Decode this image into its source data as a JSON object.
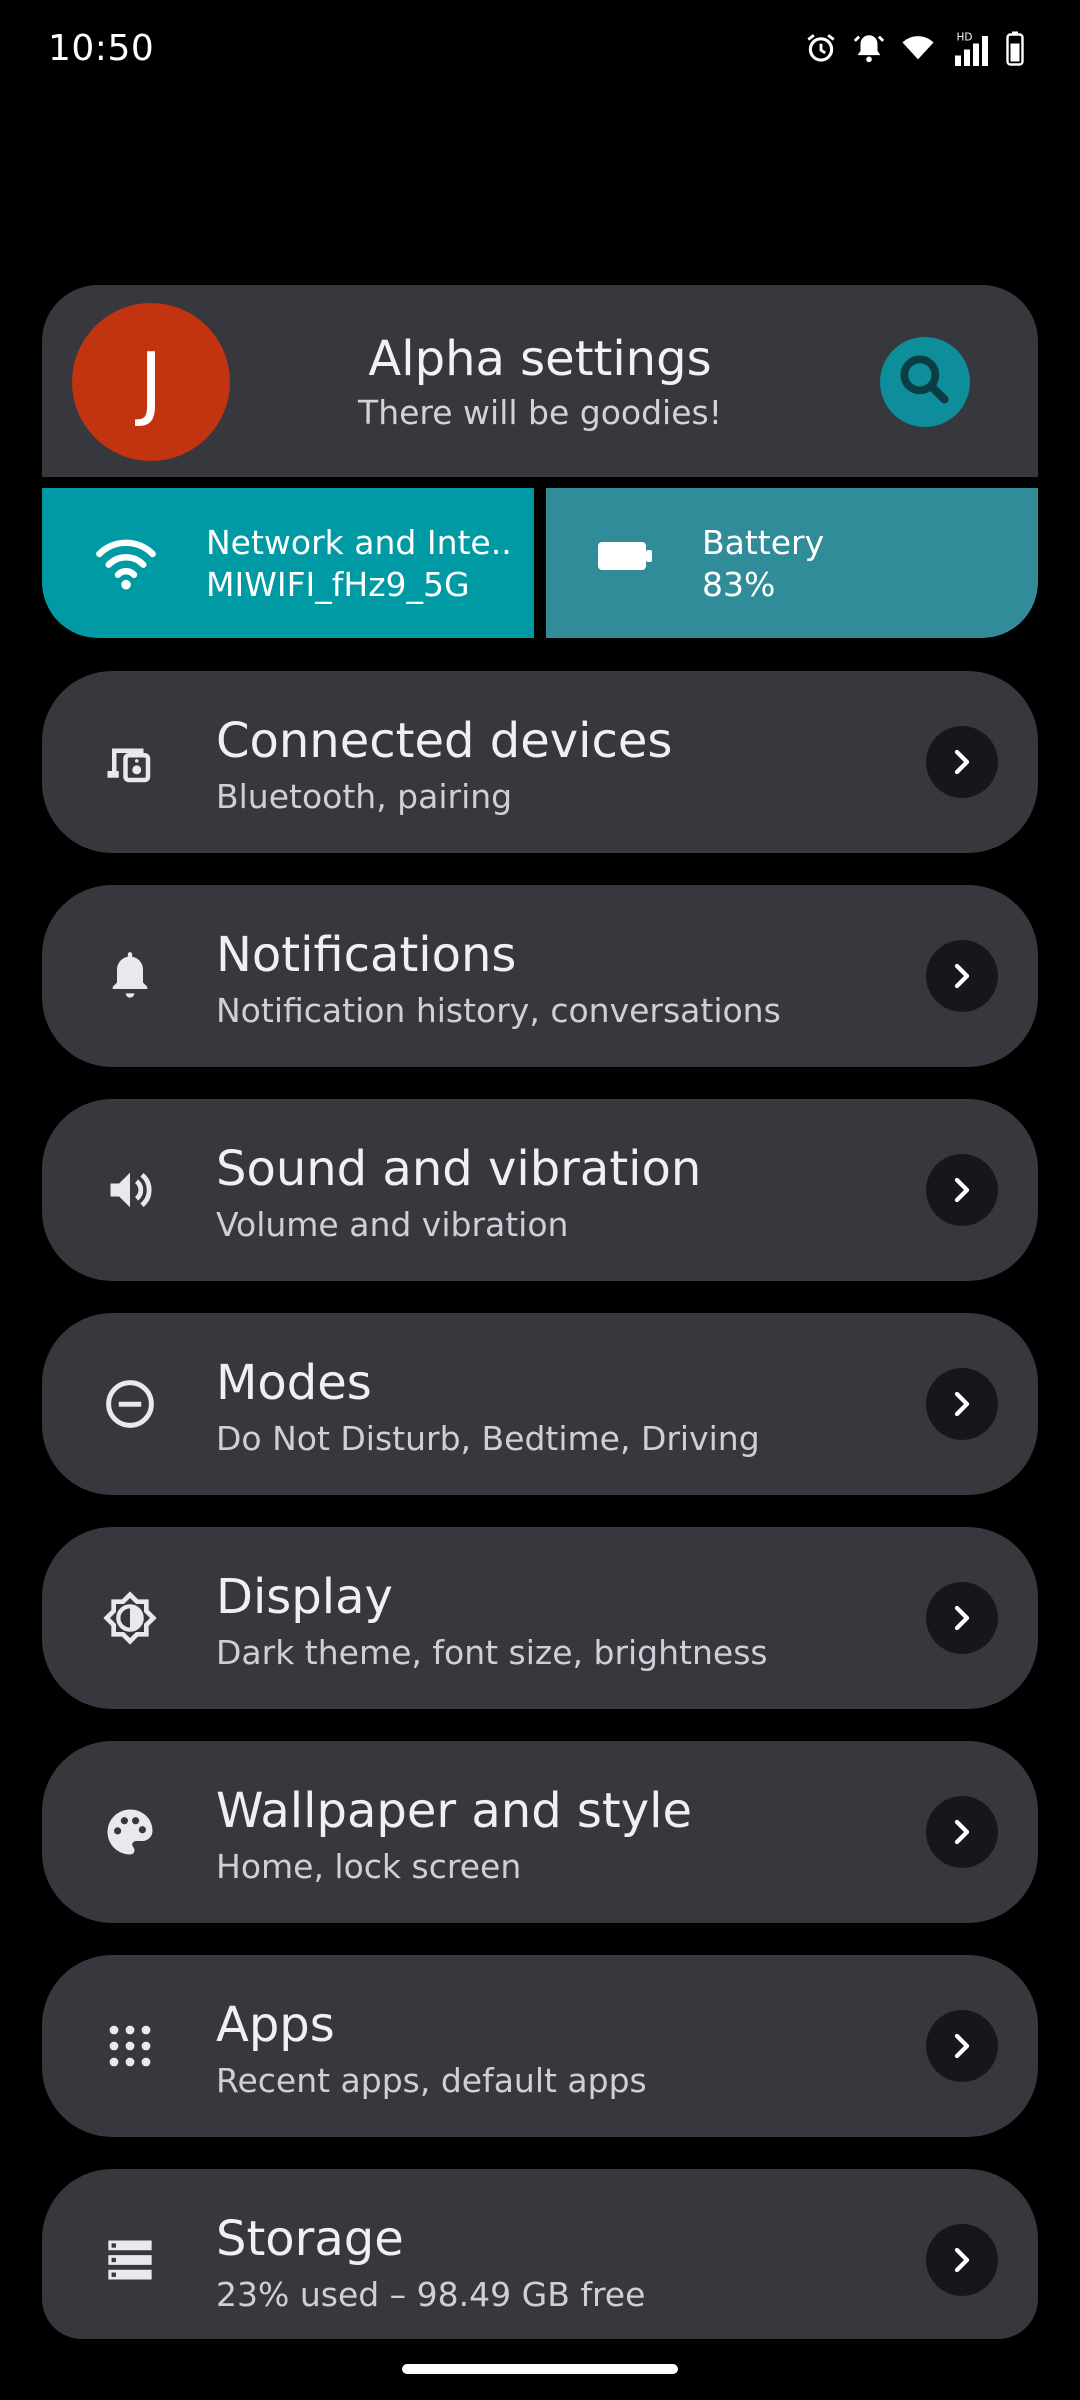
{
  "status_bar": {
    "time": "10:50",
    "icons": [
      "alarm-icon",
      "alert-icon",
      "wifi-icon",
      "signal-icon",
      "battery-icon"
    ],
    "network_type": "HD"
  },
  "header": {
    "avatar_letter": "J",
    "title": "Alpha settings",
    "subtitle": "There will be goodies!",
    "search_icon": "search-icon"
  },
  "tiles": {
    "network": {
      "title": "Network and Inte..",
      "value": "MIWIFI_fHz9_5G",
      "icon": "wifi-icon",
      "color": "#009aa5"
    },
    "battery": {
      "title": "Battery",
      "value": "83%",
      "icon": "battery-icon",
      "color": "#308c99"
    }
  },
  "items": [
    {
      "title": "Connected devices",
      "subtitle": "Bluetooth, pairing",
      "icon": "devices-icon"
    },
    {
      "title": "Notifications",
      "subtitle": "Notification history, conversations",
      "icon": "bell-icon"
    },
    {
      "title": "Sound and vibration",
      "subtitle": "Volume and vibration",
      "icon": "volume-icon"
    },
    {
      "title": "Modes",
      "subtitle": "Do Not Disturb, Bedtime, Driving",
      "icon": "do-not-disturb-icon"
    },
    {
      "title": "Display",
      "subtitle": "Dark theme, font size, brightness",
      "icon": "brightness-icon"
    },
    {
      "title": "Wallpaper and style",
      "subtitle": "Home, lock screen",
      "icon": "palette-icon"
    },
    {
      "title": "Apps",
      "subtitle": "Recent apps, default apps",
      "icon": "apps-grid-icon"
    },
    {
      "title": "Storage",
      "subtitle": "23% used – 98.49 GB free",
      "icon": "storage-icon"
    }
  ],
  "colors": {
    "background": "#000000",
    "card": "#37373e",
    "avatar": "#c2330f",
    "accent": "#0e8d9b"
  }
}
